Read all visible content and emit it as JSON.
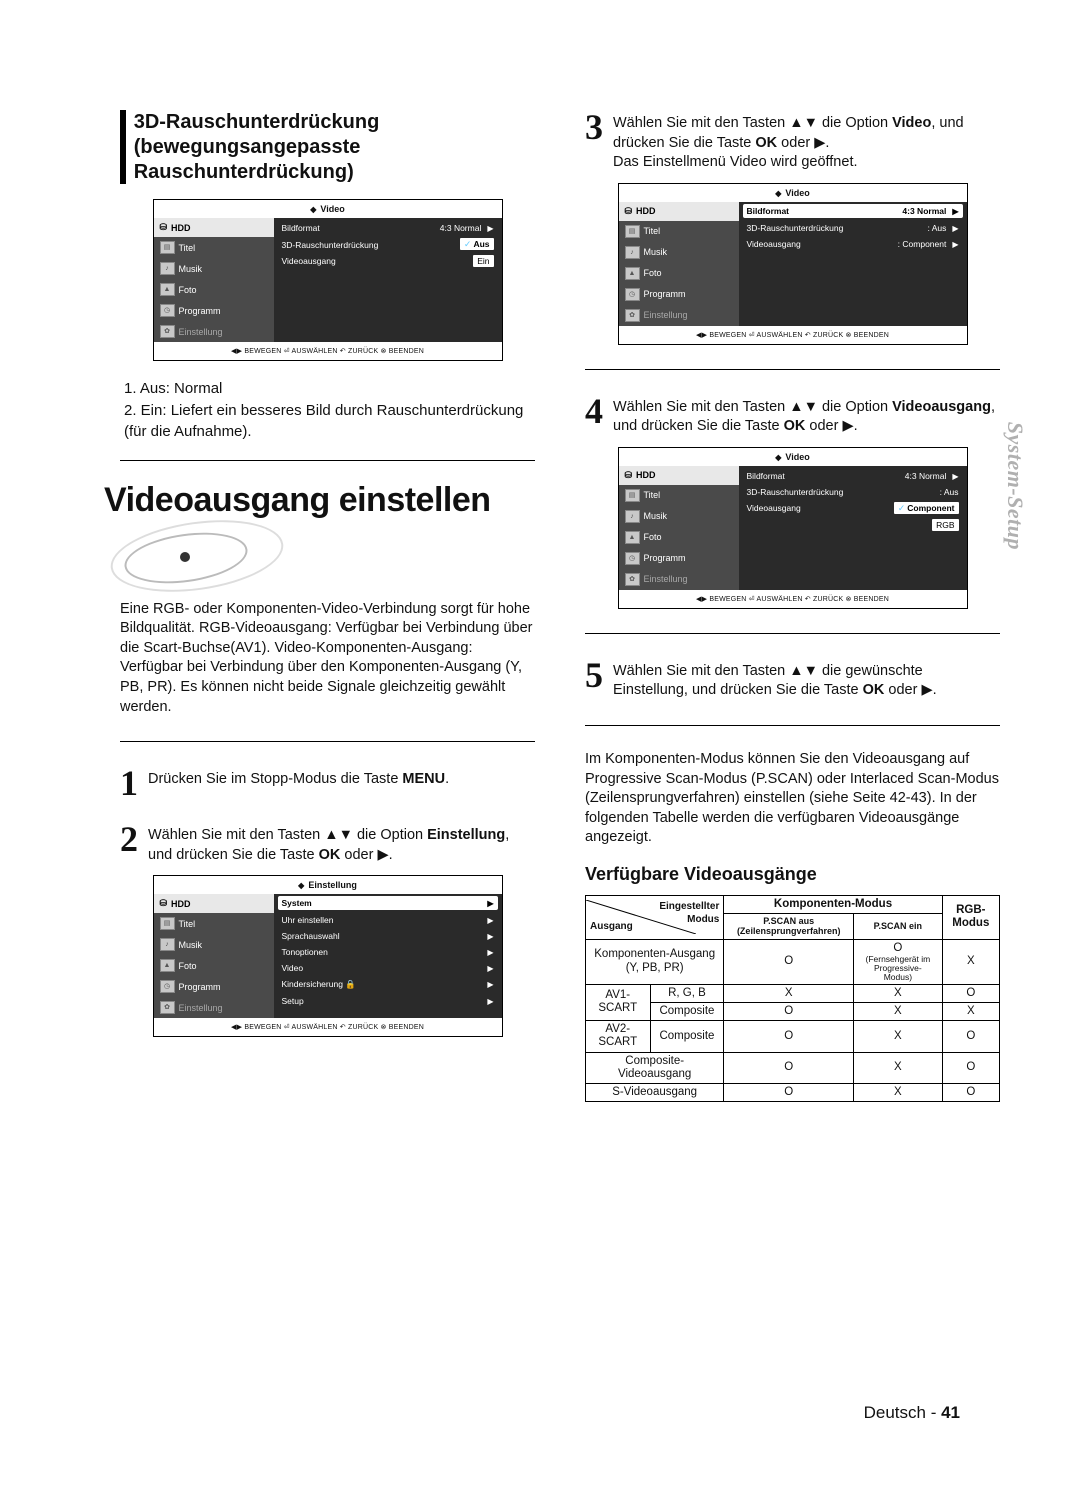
{
  "side_tab": "System-Setup",
  "left": {
    "section_title": "3D-Rauschunterdrückung (bewegungsangepasste Rauschunterdrückung)",
    "tv1": {
      "header_icon": "◆",
      "header": "Video",
      "nav": {
        "hdd": "HDD",
        "titel": "Titel",
        "musik": "Musik",
        "foto": "Foto",
        "programm": "Programm",
        "einstellung": "Einstellung"
      },
      "rows": [
        {
          "label": "Bildformat",
          "value": "4:3 Normal",
          "arrow": "▶"
        },
        {
          "label": "3D-Rauschunterdrückung",
          "sel": true,
          "values": [
            "Aus",
            "Ein"
          ],
          "check": true
        },
        {
          "label": "Videoausgang",
          "value": "",
          "arrow": ""
        }
      ],
      "foot": "◀▶ BEWEGEN   ⏎ AUSWÄHLEN   ↶ ZURÜCK   ⊗ BEENDEN"
    },
    "notes": {
      "n1": "1. Aus: Normal",
      "n2": "2. Ein: Liefert ein besseres Bild durch Rauschunterdrückung (für die Aufnahme)."
    },
    "main_title": "Videoausgang einstellen",
    "intro_para": "Eine RGB- oder Komponenten-Video-Verbindung sorgt für hohe Bildqualität. RGB-Videoausgang: Verfügbar bei Verbindung über die Scart-Buchse(AV1). Video-Komponenten-Ausgang: Verfügbar bei Verbindung über den Komponenten-Ausgang (Y, PB, PR). Es können nicht beide Signale gleichzeitig gewählt werden.",
    "step1": {
      "num": "1",
      "a": "Drücken Sie im Stopp-Modus die Taste ",
      "b": "MENU",
      "c": "."
    },
    "step2": {
      "num": "2",
      "a": "Wählen Sie mit den Tasten ▲▼ die Option ",
      "b": "Einstellung",
      "c": ", und drücken Sie die Taste ",
      "d": "OK",
      "e": " oder ▶."
    },
    "tv2": {
      "header_icon": "◆",
      "header": "Einstellung",
      "rows": [
        {
          "label": "System",
          "arrow": "▶",
          "sel": true
        },
        {
          "label": "Uhr einstellen",
          "arrow": "▶"
        },
        {
          "label": "Sprachauswahl",
          "arrow": "▶"
        },
        {
          "label": "Tonoptionen",
          "arrow": "▶"
        },
        {
          "label": "Video",
          "arrow": "▶"
        },
        {
          "label": "Kindersicherung 🔒",
          "arrow": "▶"
        },
        {
          "label": "Setup",
          "arrow": "▶"
        }
      ],
      "foot": "◀▶ BEWEGEN   ⏎ AUSWÄHLEN   ↶ ZURÜCK   ⊗ BEENDEN"
    }
  },
  "right": {
    "step3": {
      "num": "3",
      "a": "Wählen Sie mit den Tasten ▲▼ die Option ",
      "b": "Video",
      "c": ", und drücken Sie die Taste ",
      "d": "OK",
      "e": " oder ▶.",
      "f": "Das Einstellmenü Video wird geöffnet."
    },
    "tv3": {
      "header_icon": "◆",
      "header": "Video",
      "rows": [
        {
          "label": "Bildformat",
          "value": "4:3 Normal",
          "arrow": "▶",
          "sel": true
        },
        {
          "label": "3D-Rauschunterdrückung",
          "value": ": Aus",
          "arrow": "▶"
        },
        {
          "label": "Videoausgang",
          "value": ": Component",
          "arrow": "▶"
        }
      ],
      "foot": "◀▶ BEWEGEN   ⏎ AUSWÄHLEN   ↶ ZURÜCK   ⊗ BEENDEN"
    },
    "step4": {
      "num": "4",
      "a": "Wählen Sie mit den Tasten ▲▼ die Option ",
      "b": "Videoausgang",
      "c": ", und drücken Sie die Taste ",
      "d": "OK",
      "e": " oder ▶."
    },
    "tv4": {
      "header_icon": "◆",
      "header": "Video",
      "rows": [
        {
          "label": "Bildformat",
          "value": "4:3 Normal",
          "arrow": "▶"
        },
        {
          "label": "3D-Rauschunterdrückung",
          "value": ": Aus",
          "arrow": ""
        },
        {
          "label": "Videoausgang",
          "sel": true,
          "values": [
            "Component",
            "RGB"
          ],
          "check": true
        }
      ],
      "foot": "◀▶ BEWEGEN   ⏎ AUSWÄHLEN   ↶ ZURÜCK   ⊗ BEENDEN"
    },
    "step5": {
      "num": "5",
      "a": "Wählen Sie mit den Tasten ▲▼ die gewünschte Einstellung, und drücken Sie die Taste ",
      "b": "OK",
      "c": " oder ▶."
    },
    "outputs_para": "Im Komponenten-Modus können Sie den Videoausgang auf Progressive Scan-Modus (P.SCAN) oder Interlaced Scan-Modus (Zeilensprungverfahren) einstellen (siehe Seite 42-43). In der folgenden Tabelle werden die verfügbaren Videoausgänge angezeigt.",
    "outputs_title": "Verfügbare Videoausgänge",
    "table": {
      "diag_top": "Eingestellter",
      "diag_top2": "Modus",
      "diag_left": "Ausgang",
      "colgroup": "Komponenten-Modus",
      "col1": "P.SCAN aus (Zeilensprungverfahren)",
      "col2": "P.SCAN ein",
      "col3": "RGB-Modus",
      "rows": [
        {
          "label": "Komponenten-Ausgang (Y, PB, PR)",
          "c1": "O",
          "c2": "O",
          "c2note": "(Fernsehgerät im Progressive-Modus)",
          "c3": "X"
        },
        {
          "label": "AV1-SCART",
          "sub": "R, G, B",
          "c1": "X",
          "c2": "X",
          "c3": "O"
        },
        {
          "sub": "Composite",
          "c1": "O",
          "c2": "X",
          "c3": "X"
        },
        {
          "label": "AV2-SCART",
          "sub": "Composite",
          "c1": "O",
          "c2": "X",
          "c3": "O"
        },
        {
          "label": "Composite-Videoausgang",
          "c1": "O",
          "c2": "X",
          "c3": "O"
        },
        {
          "label": "S-Videoausgang",
          "c1": "O",
          "c2": "X",
          "c3": "O"
        }
      ]
    }
  },
  "footer": {
    "lang": "Deutsch",
    "sep": " - ",
    "page": "41"
  }
}
